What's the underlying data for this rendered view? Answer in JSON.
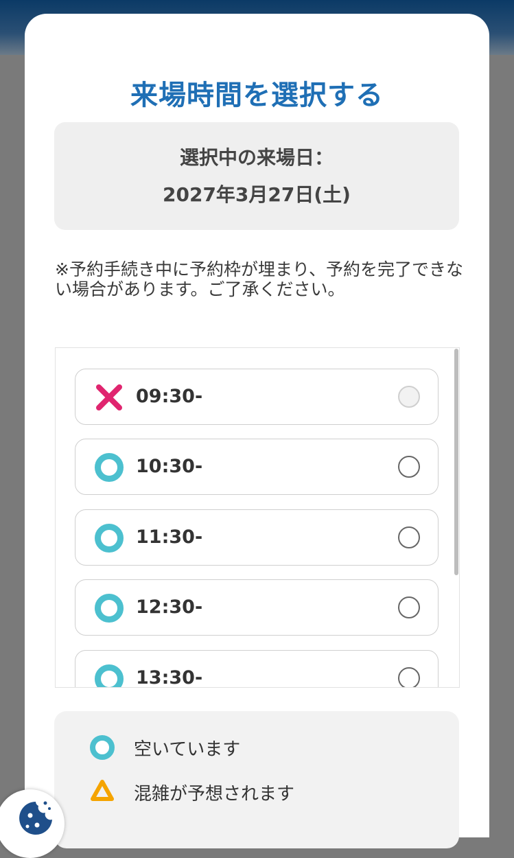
{
  "modal": {
    "title": "来場時間を選択する",
    "date_label": "選択中の来場日：",
    "date_value": "2027年3月27日(土)",
    "notice": "※予約手続き中に予約枠が埋まり、予約を完了できない場合があります。ご了承ください。"
  },
  "slots": [
    {
      "time": "09:30-",
      "status": "full",
      "icon": "cross-icon",
      "enabled": false
    },
    {
      "time": "10:30-",
      "status": "available",
      "icon": "circle-icon",
      "enabled": true
    },
    {
      "time": "11:30-",
      "status": "available",
      "icon": "circle-icon",
      "enabled": true
    },
    {
      "time": "12:30-",
      "status": "available",
      "icon": "circle-icon",
      "enabled": true
    },
    {
      "time": "13:30-",
      "status": "available",
      "icon": "circle-icon",
      "enabled": true
    }
  ],
  "legend": [
    {
      "label": "空いています",
      "icon": "circle-icon"
    },
    {
      "label": "混雑が予想されます",
      "icon": "triangle-icon"
    }
  ],
  "colors": {
    "title": "#1f6fb5",
    "available": "#4cc0cf",
    "full": "#e0256f",
    "crowded": "#f5a400"
  },
  "cookie_button": {
    "icon": "cookie-icon"
  }
}
